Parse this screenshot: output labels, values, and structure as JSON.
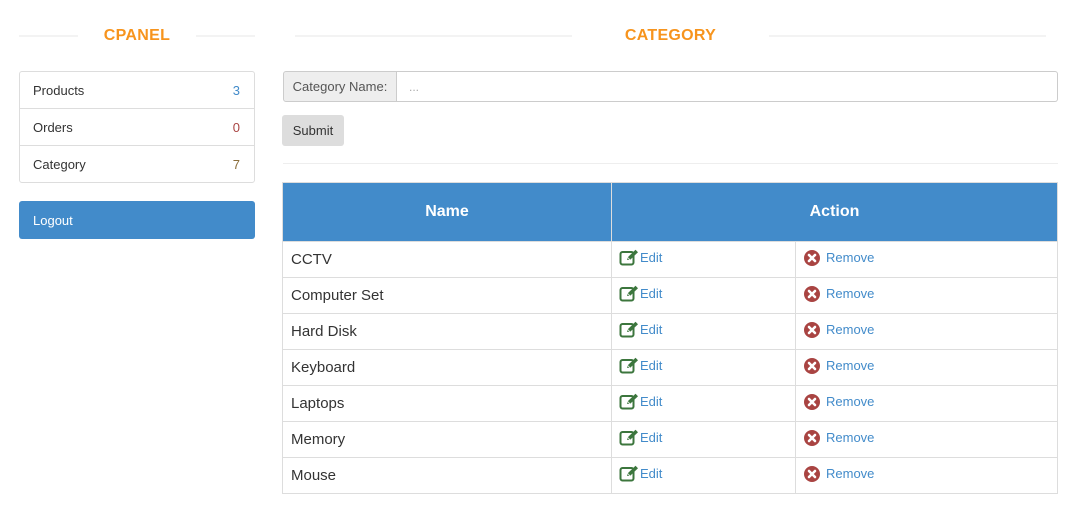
{
  "sidebar": {
    "heading": "CPANEL",
    "items": [
      {
        "label": "Products",
        "count": "3",
        "count_color": "#428bca"
      },
      {
        "label": "Orders",
        "count": "0",
        "count_color": "#a94442"
      },
      {
        "label": "Category",
        "count": "7",
        "count_color": "#8a6d3b"
      }
    ],
    "logout_label": "Logout"
  },
  "main": {
    "heading": "CATEGORY",
    "form": {
      "label": "Category Name:",
      "placeholder": "...",
      "value": "",
      "submit_label": "Submit"
    },
    "table": {
      "columns": [
        "Name",
        "Action"
      ],
      "rows": [
        {
          "name": "CCTV",
          "edit": "Edit",
          "remove": "Remove"
        },
        {
          "name": "Computer Set",
          "edit": "Edit",
          "remove": "Remove"
        },
        {
          "name": "Hard Disk",
          "edit": "Edit",
          "remove": "Remove"
        },
        {
          "name": "Keyboard",
          "edit": "Edit",
          "remove": "Remove"
        },
        {
          "name": "Laptops",
          "edit": "Edit",
          "remove": "Remove"
        },
        {
          "name": "Memory",
          "edit": "Edit",
          "remove": "Remove"
        },
        {
          "name": "Mouse",
          "edit": "Edit",
          "remove": "Remove"
        }
      ]
    }
  },
  "colors": {
    "accent_orange": "#f7941d",
    "primary_blue": "#428bca",
    "edit_icon_green": "#3c763d",
    "remove_icon_red": "#a94442"
  },
  "icons": {
    "edit": "edit-icon",
    "remove": "remove-icon"
  }
}
